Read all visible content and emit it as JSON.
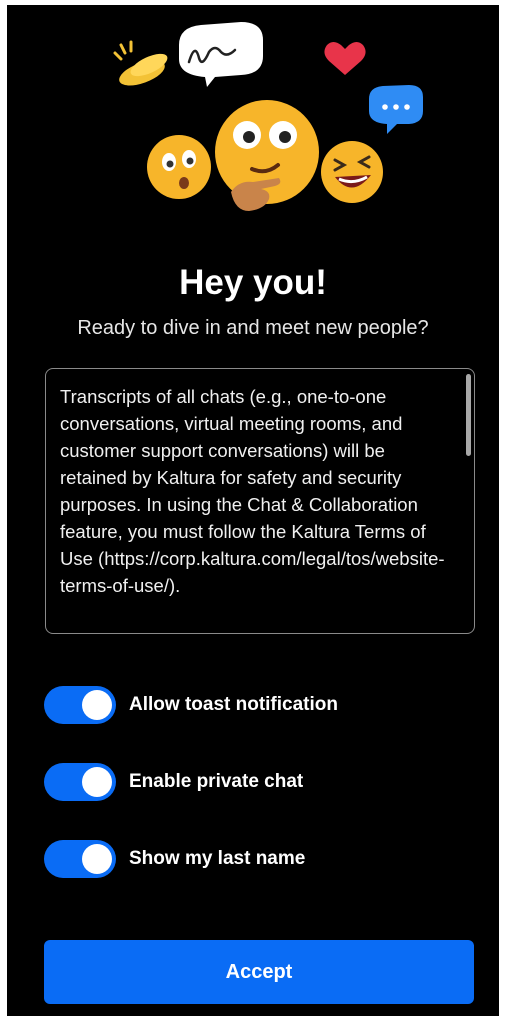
{
  "header": {
    "title": "Hey you!",
    "subtitle": "Ready to dive in and meet new people?"
  },
  "illustration": {
    "icons": [
      "clapping-hands-icon",
      "speech-bubble-icon",
      "heart-icon",
      "chat-bubble-icon",
      "surprised-face-icon",
      "thinking-face-icon",
      "laughing-face-icon"
    ]
  },
  "terms": {
    "text": "Transcripts of all chats (e.g., one-to-one conversations, virtual meeting rooms, and customer support conversations) will be retained by Kaltura for safety and security purposes. In using the Chat & Collaboration feature, you must follow the Kaltura Terms of Use (https://corp.kaltura.com/legal/tos/website-terms-of-use/)."
  },
  "settings": [
    {
      "label": "Allow toast notification",
      "enabled": true
    },
    {
      "label": "Enable private chat",
      "enabled": true
    },
    {
      "label": "Show my last name",
      "enabled": true
    }
  ],
  "actions": {
    "accept_label": "Accept"
  },
  "colors": {
    "background": "#000000",
    "accent": "#0a6cf5",
    "text": "#ffffff"
  }
}
